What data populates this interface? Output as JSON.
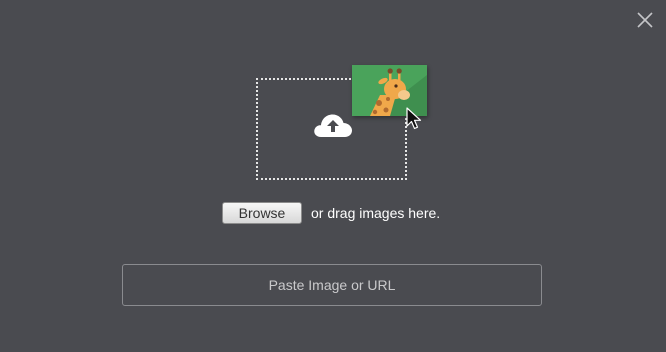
{
  "dialog": {
    "close_icon": "close-icon",
    "upload_icon": "cloud-upload-icon",
    "preview_icon": "giraffe-image-icon",
    "cursor_icon": "mouse-pointer-icon",
    "browse_label": "Browse",
    "drag_text": "or drag images here.",
    "url_placeholder": "Paste Image or URL",
    "url_value": ""
  },
  "colors": {
    "background": "#4a4b50",
    "preview_card": "#4aa35b",
    "text": "#ffffff"
  }
}
